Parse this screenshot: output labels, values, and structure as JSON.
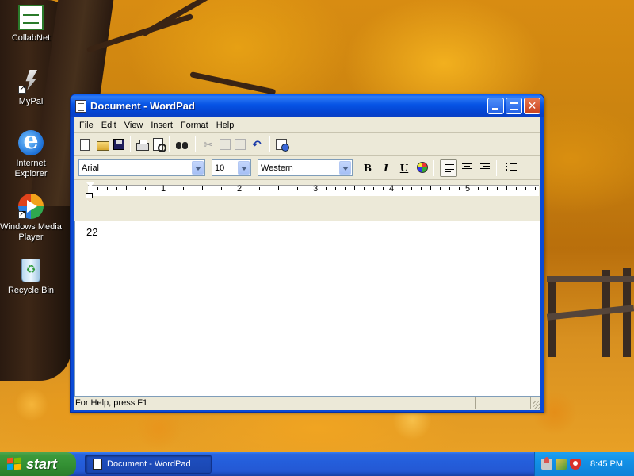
{
  "desktop": {
    "icons": [
      {
        "label": "CollabNet",
        "icon": "collabnet-icon"
      },
      {
        "label": "MyPal",
        "icon": "mypal-icon"
      },
      {
        "label_line1": "Internet",
        "label_line2": "Explorer",
        "icon": "internet-explorer-icon"
      },
      {
        "label_line1": "Windows Media",
        "label_line2": "Player",
        "icon": "windows-media-player-icon"
      },
      {
        "label": "Recycle Bin",
        "icon": "recycle-bin-icon"
      }
    ]
  },
  "window": {
    "title": "Document - WordPad",
    "menu": [
      "File",
      "Edit",
      "View",
      "Insert",
      "Format",
      "Help"
    ],
    "toolbar_icons": [
      "new-icon",
      "open-icon",
      "save-icon",
      "print-icon",
      "print-preview-icon",
      "find-icon",
      "cut-icon",
      "copy-icon",
      "paste-icon",
      "undo-icon",
      "date-time-icon"
    ],
    "format_bar": {
      "font": "Arial",
      "size": "10",
      "script": "Western",
      "alignment": "left"
    },
    "ruler": [
      "1",
      "2",
      "3",
      "4",
      "5"
    ],
    "document_text": "22",
    "status": "For Help, press F1"
  },
  "taskbar": {
    "start_label": "start",
    "task_label": "Document - WordPad",
    "clock": "8:45 PM"
  },
  "colors": {
    "titlebar_blue": "#0653e4",
    "taskbar_blue": "#245edb",
    "start_green": "#339033",
    "window_face": "#ece9d8"
  }
}
